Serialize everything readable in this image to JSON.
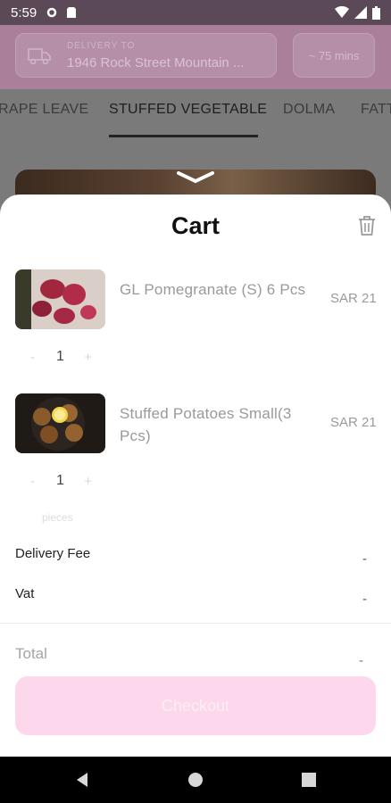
{
  "status_bar": {
    "time": "5:59"
  },
  "header": {
    "delivery_label": "DELIVERY TO",
    "delivery_address": "1946 Rock Street Mountain ...",
    "eta": "~ 75 mins"
  },
  "tabs": [
    {
      "label": "RAPE LEAVE"
    },
    {
      "label": "STUFFED VEGETABLE"
    },
    {
      "label": "DOLMA"
    },
    {
      "label": "FATT"
    }
  ],
  "cart": {
    "title": "Cart",
    "items": [
      {
        "name": "GL Pomegranate (S) 6 Pcs",
        "price": "SAR 21",
        "qty": "1"
      },
      {
        "name": "Stuffed Potatoes Small(3 Pcs)",
        "price": "SAR 21",
        "qty": "1"
      }
    ],
    "qty_minus": "-",
    "qty_plus": "+",
    "pieces_label": "pieces",
    "delivery_fee_label": "Delivery Fee",
    "delivery_fee_value": "-",
    "vat_label": "Vat",
    "vat_value": "-",
    "total_label": "Total",
    "total_value": "-",
    "checkout_label": "Checkout"
  },
  "colors": {
    "accent": "#fdd7ec",
    "header": "#a97f9a"
  }
}
